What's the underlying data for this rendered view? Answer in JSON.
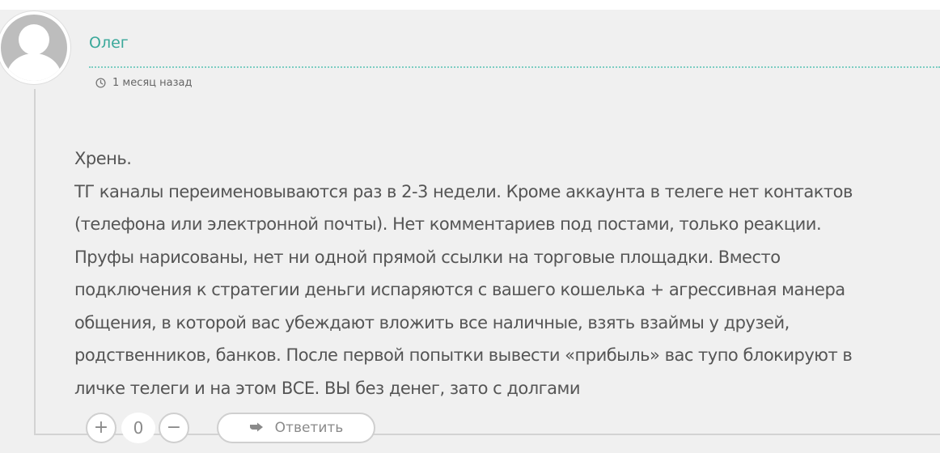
{
  "comment": {
    "author": "Олег",
    "timestamp": "1 месяц назад",
    "lines": [
      "Хрень.",
      "ТГ каналы переименовываются раз в 2-3 недели. Кроме аккаунта в телеге нет контактов",
      "(телефона или электронной почты). Нет комментариев под постами, только реакции.",
      "Пруфы нарисованы, нет ни одной прямой ссылки на торговые площадки. Вместо",
      "подключения к стратегии деньги испаряются с вашего кошелька + агрессивная манера",
      "общения, в которой вас убеждают вложить все наличные, взять взаймы у друзей,",
      "родственников, банков. После первой попытки вывести «прибыль» вас тупо блокируют в",
      "личке телеги и на этом ВСЕ. ВЫ без денег, зато с долгами"
    ]
  },
  "actions": {
    "plus_label": "+",
    "vote_count": "0",
    "minus_label": "−",
    "reply_label": "Ответить"
  },
  "colors": {
    "accent": "#3aa89a",
    "card_background": "#f0f0f0",
    "text": "#555555"
  },
  "icons": {
    "avatar": "default-user-avatar",
    "time": "clock-icon",
    "reply": "reply-arrow-icon"
  }
}
